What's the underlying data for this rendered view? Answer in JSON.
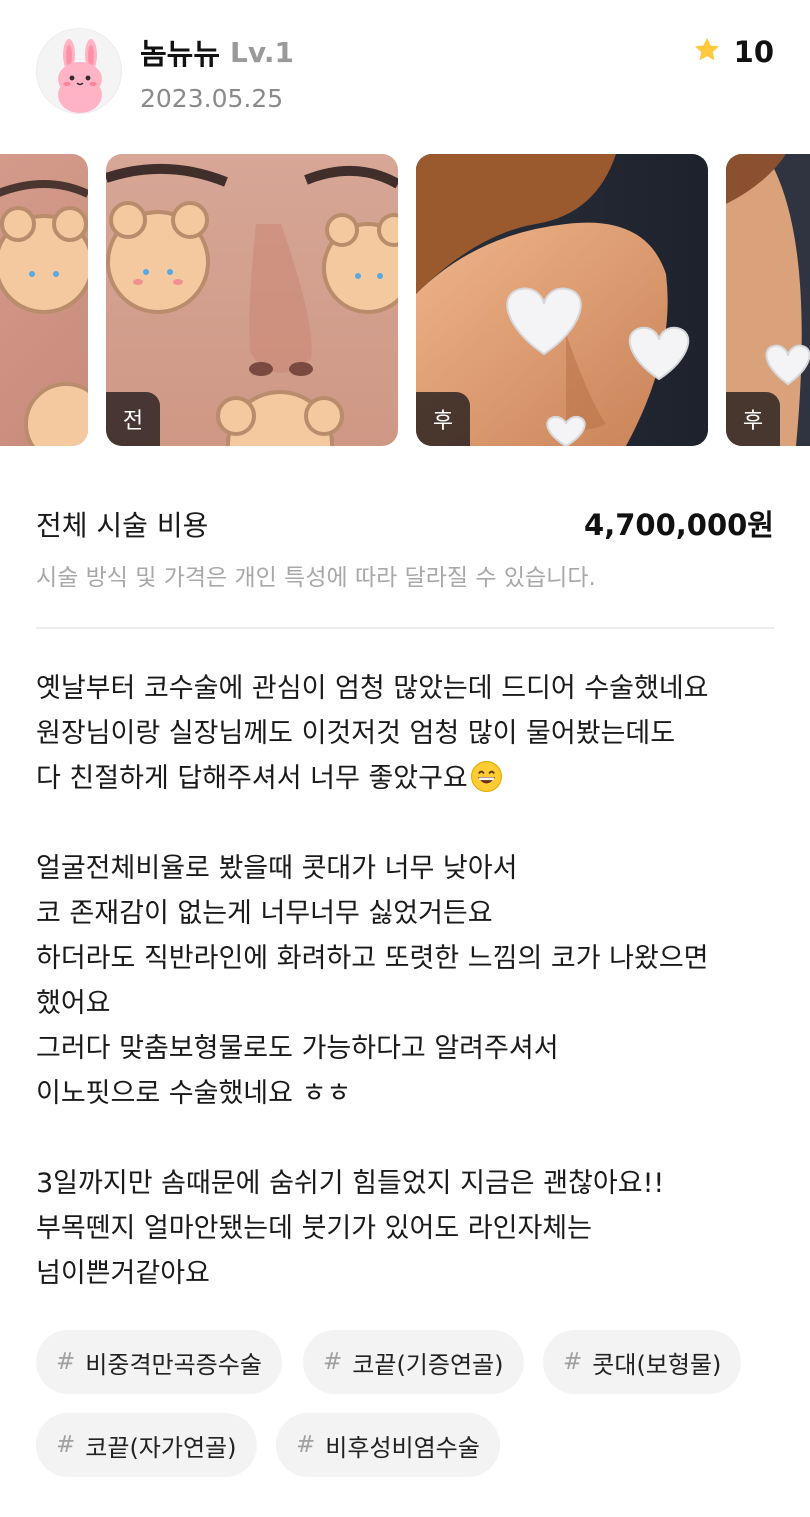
{
  "author": {
    "name": "놈뉴뉴",
    "level": "Lv.1",
    "date": "2023.05.25",
    "avatar_icon": "bunny-avatar-icon"
  },
  "rating": {
    "icon": "star-icon",
    "value": "10",
    "color": "#FFC83D"
  },
  "photos": [
    {
      "badge": ""
    },
    {
      "badge": "전"
    },
    {
      "badge": "후"
    },
    {
      "badge": "후"
    }
  ],
  "cost": {
    "label": "전체 시술 비용",
    "value": "4,700,000원",
    "note": "시술 방식 및 가격은 개인 특성에 따라 달라질 수 있습니다."
  },
  "review": {
    "lines": [
      "옛날부터 코수술에 관심이 엄청 많았는데 드디어 수술했네요",
      "원장님이랑 실장님께도 이것저것 엄청 많이 물어봤는데도",
      "다 친절하게 답해주셔서 너무 좋았구요",
      "",
      "얼굴전체비율로 봤을때 콧대가 너무 낮아서",
      "코 존재감이 없는게 너무너무 싫었거든요",
      "하더라도 직반라인에 화려하고 또렷한 느낌의 코가 나왔으면",
      "했어요",
      "그러다 맞춤보형물로도 가능하다고 알려주셔서",
      "이노핏으로 수술했네요 ㅎㅎ",
      "",
      "3일까지만 솜때문에 숨쉬기 힘들었지 지금은 괜찮아요!!",
      "부목뗀지 얼마안됐는데 붓기가 있어도 라인자체는",
      "넘이쁜거같아요"
    ],
    "emoji_icon": "grinning-face-icon"
  },
  "tags": [
    {
      "hash": "#",
      "text": "비중격만곡증수술"
    },
    {
      "hash": "#",
      "text": "코끝(기증연골)"
    },
    {
      "hash": "#",
      "text": "콧대(보형물)"
    },
    {
      "hash": "#",
      "text": "코끝(자가연골)"
    },
    {
      "hash": "#",
      "text": "비후성비염수술"
    }
  ]
}
